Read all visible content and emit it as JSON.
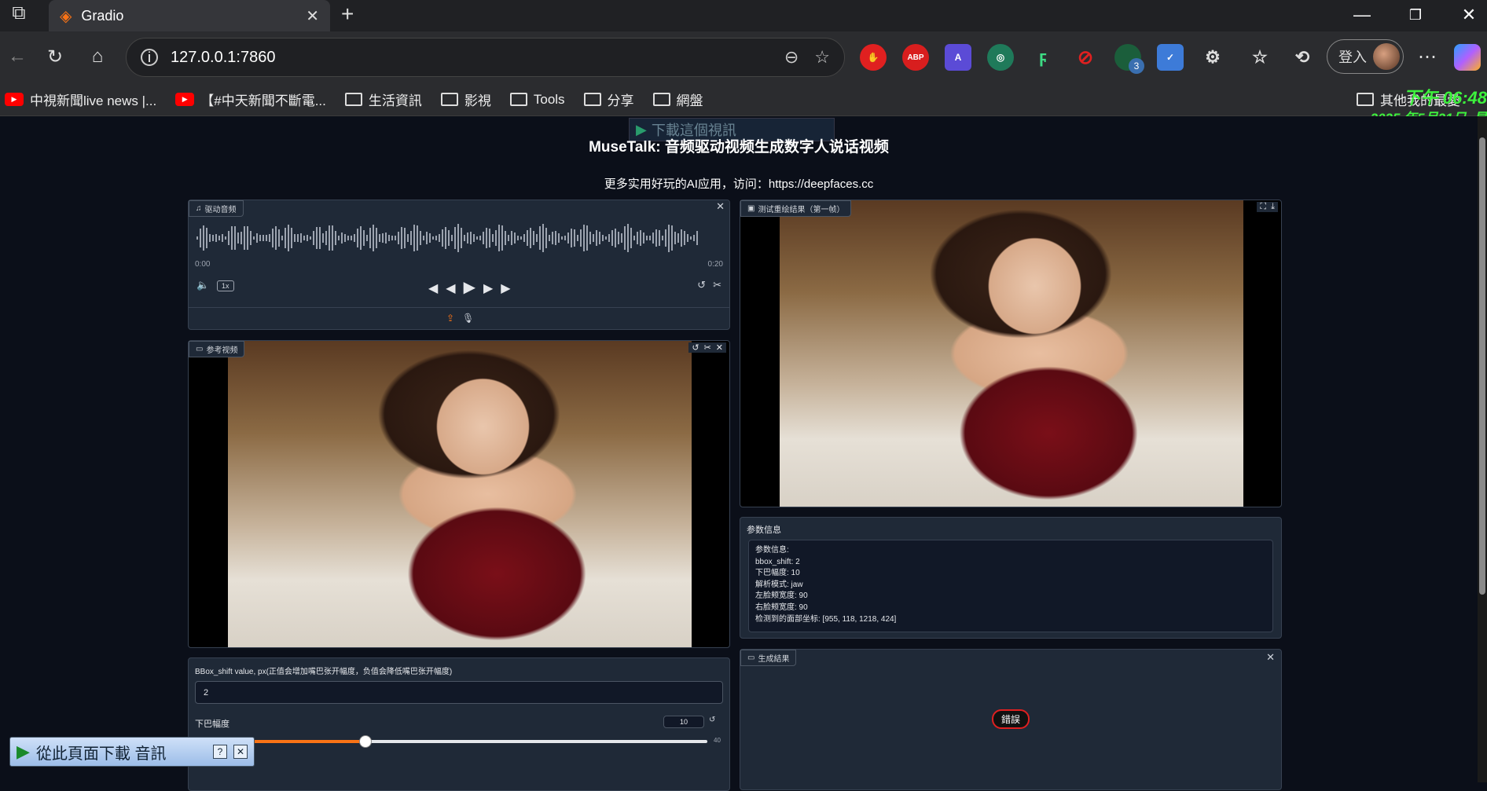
{
  "browser": {
    "tab_title": "Gradio",
    "url": "127.0.0.1:7860",
    "login_label": "登入",
    "bookmarks": [
      {
        "label": "中視新聞live news |...",
        "type": "youtube"
      },
      {
        "label": "【#中天新聞不斷電...",
        "type": "youtube"
      },
      {
        "label": "生活資訊",
        "type": "folder"
      },
      {
        "label": "影視",
        "type": "folder"
      },
      {
        "label": "Tools",
        "type": "folder"
      },
      {
        "label": "分享",
        "type": "folder"
      },
      {
        "label": "網盤",
        "type": "folder"
      }
    ],
    "other_bookmarks": "其他我的最愛",
    "extension_badge": "3",
    "abp_label": "ABP"
  },
  "overlay": {
    "clock_time": "下午 06:48",
    "clock_date": "2025 年5月21日, 星",
    "download_top": "下載這個視訊",
    "download_bottom": "從此頁面下載 音訊"
  },
  "app": {
    "title": "MuseTalk: 音频驱动视频生成数字人说话视频",
    "subtitle": "更多实用好玩的AI应用，访问：https://deepfaces.cc",
    "audio": {
      "label": "驱动音频",
      "time_start": "0:00",
      "time_end": "0:20",
      "speed": "1x"
    },
    "ref_video": {
      "label": "参考视频"
    },
    "preview": {
      "label": "测试重绘结果（第一帧）"
    },
    "params": {
      "label": "参数信息",
      "lines": [
        "参数信息:",
        "bbox_shift: 2",
        "下巴幅度: 10",
        "解析模式: jaw",
        "左脸颊宽度: 90",
        "右脸颊宽度: 90",
        "检测到的面部坐标: [955, 118, 1218, 424]"
      ]
    },
    "result": {
      "label": "生成結果",
      "error": "錯誤"
    },
    "bbox": {
      "label": "BBox_shift value, px(正值会增加嘴巴张开幅度，负值会降低嘴巴张开幅度)",
      "value": "2"
    },
    "chin": {
      "label": "下巴幅度",
      "value": "10",
      "max": "40",
      "fraction": 0.25
    }
  }
}
